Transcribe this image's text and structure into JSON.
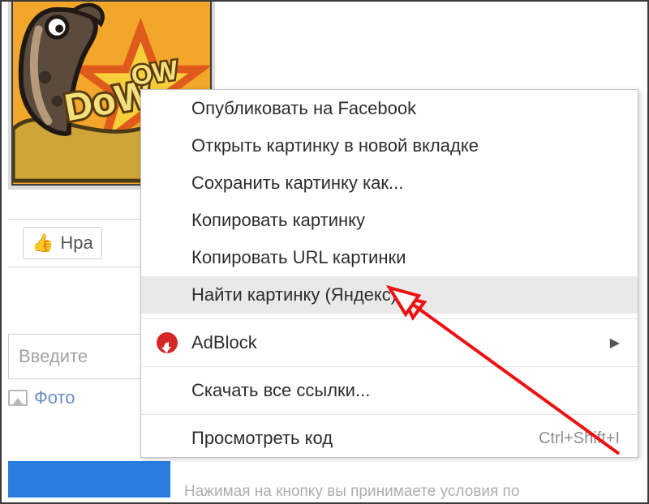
{
  "background": {
    "like_button_label": "Нра",
    "comment_placeholder": "Введите",
    "photo_attach_label": "Фото",
    "footer_text_fragment": "Нажимая на кнопку  вы принимаете условия по"
  },
  "context_menu": {
    "items": {
      "publish_fb": "Опубликовать на Facebook",
      "open_new_tab": "Открыть картинку в новой вкладке",
      "save_as": "Сохранить картинку как...",
      "copy_image": "Копировать картинку",
      "copy_url": "Копировать URL картинки",
      "search_yandex": "Найти картинку (Яндекс)",
      "adblock": "AdBlock",
      "download_links": "Скачать все ссылки...",
      "inspect": "Просмотреть код"
    },
    "inspect_shortcut": "Ctrl+Shift+I"
  }
}
